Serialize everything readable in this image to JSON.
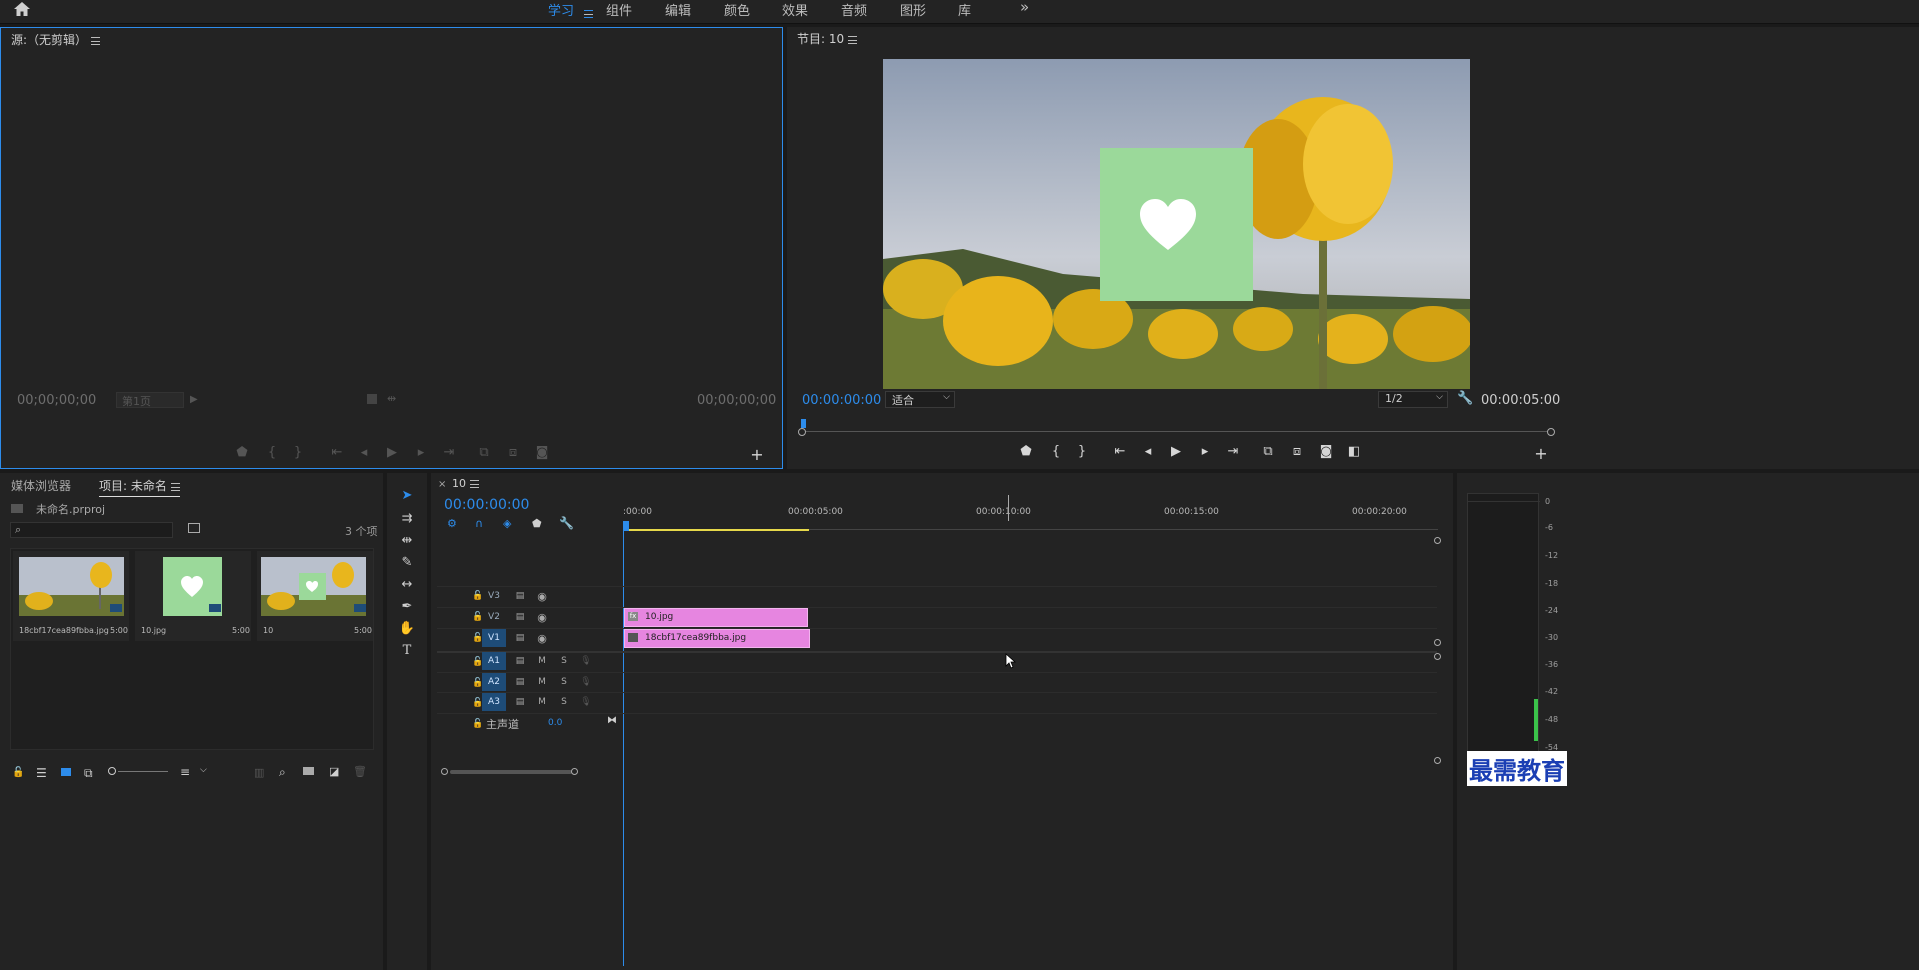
{
  "workspaces": [
    "学习",
    "组件",
    "编辑",
    "颜色",
    "效果",
    "音频",
    "图形",
    "库"
  ],
  "workspace_active": "学习",
  "source_panel": {
    "title": "源:（无剪辑）",
    "timecode_left": "00;00;00;00",
    "timecode_right": "00;00;00;00",
    "page_select": "第1页"
  },
  "program_panel": {
    "title": "节目: 10",
    "timecode_left": "00:00:00:00",
    "timecode_right": "00:00:05:00",
    "fit_select": "适合",
    "res_select": "1/2"
  },
  "project_panel": {
    "tabs": [
      "媒体浏览器",
      "项目: 未命名"
    ],
    "active_tab": "项目: 未命名",
    "project_file": "未命名.prproj",
    "item_count": "3 个项",
    "items": [
      {
        "name": "18cbf17cea89fbba.jpg",
        "duration": "5:00",
        "thumb": "tulip"
      },
      {
        "name": "10.jpg",
        "duration": "5:00",
        "thumb": "heart"
      },
      {
        "name": "10",
        "duration": "5:00",
        "thumb": "sequence"
      }
    ]
  },
  "timeline": {
    "tab": "10",
    "timecode": "00:00:00:00",
    "ruler": [
      ":00:00",
      "00:00:05:00",
      "00:00:10:00",
      "00:00:15:00",
      "00:00:20:00"
    ],
    "video_tracks": [
      "V3",
      "V2",
      "V1"
    ],
    "audio_tracks": [
      "A1",
      "A2",
      "A3"
    ],
    "audio_btn_m": "M",
    "audio_btn_s": "S",
    "master_label": "主声道",
    "master_value": "0.0",
    "clips": [
      {
        "track": "V2",
        "label": "10.jpg"
      },
      {
        "track": "V1",
        "label": "18cbf17cea89fbba.jpg"
      }
    ]
  },
  "meter_labels": [
    "0",
    "-6",
    "-12",
    "-18",
    "-24",
    "-30",
    "-36",
    "-42",
    "-48",
    "-54"
  ],
  "watermark": "最需教育",
  "colors": {
    "accent": "#2d8ceb",
    "clip": "#e685e0",
    "thumb_green": "#9bd99a"
  }
}
